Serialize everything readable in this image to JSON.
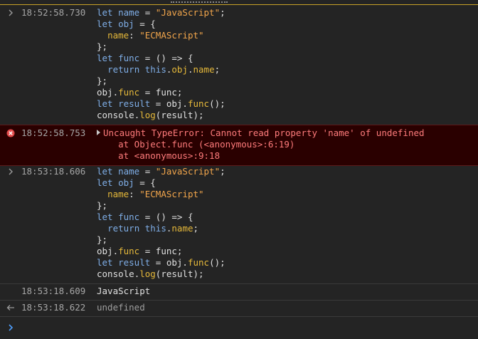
{
  "console": {
    "entries": [
      {
        "type": "input",
        "icon": "chevron-right-icon",
        "timestamp": "18:52:58.730",
        "lines": [
          [
            {
              "t": "let",
              "c": "kw"
            },
            {
              "t": " "
            },
            {
              "t": "name",
              "c": "kw"
            },
            {
              "t": " = "
            },
            {
              "t": "\"JavaScript\"",
              "c": "str"
            },
            {
              "t": ";"
            }
          ],
          [
            {
              "t": "let",
              "c": "kw"
            },
            {
              "t": " "
            },
            {
              "t": "obj",
              "c": "kw"
            },
            {
              "t": " = {"
            }
          ],
          [
            {
              "t": "  "
            },
            {
              "t": "name",
              "c": "prop"
            },
            {
              "t": ": "
            },
            {
              "t": "\"ECMAScript\"",
              "c": "str"
            }
          ],
          [
            {
              "t": "};"
            }
          ],
          [
            {
              "t": "let",
              "c": "kw"
            },
            {
              "t": " "
            },
            {
              "t": "func",
              "c": "kw"
            },
            {
              "t": " = () => {"
            }
          ],
          [
            {
              "t": "  "
            },
            {
              "t": "return",
              "c": "kw"
            },
            {
              "t": " "
            },
            {
              "t": "this",
              "c": "this"
            },
            {
              "t": "."
            },
            {
              "t": "obj",
              "c": "prop"
            },
            {
              "t": "."
            },
            {
              "t": "name",
              "c": "prop"
            },
            {
              "t": ";"
            }
          ],
          [
            {
              "t": "};"
            }
          ],
          [
            {
              "t": "obj"
            },
            {
              "t": "."
            },
            {
              "t": "func",
              "c": "prop"
            },
            {
              "t": " = func;"
            }
          ],
          [
            {
              "t": "let",
              "c": "kw"
            },
            {
              "t": " "
            },
            {
              "t": "result",
              "c": "kw"
            },
            {
              "t": " = obj."
            },
            {
              "t": "func",
              "c": "prop"
            },
            {
              "t": "();"
            }
          ],
          [
            {
              "t": "console"
            },
            {
              "t": "."
            },
            {
              "t": "log",
              "c": "prop"
            },
            {
              "t": "(result);"
            }
          ]
        ]
      },
      {
        "type": "error",
        "icon": "error-circle-icon",
        "timestamp": "18:52:58.753",
        "lines": [
          [
            {
              "t": "Uncaught TypeError: Cannot read property 'name' of undefined",
              "c": "err-text"
            }
          ],
          [
            {
              "t": "    at Object.func (<anonymous>:6:19)",
              "c": "err-text"
            }
          ],
          [
            {
              "t": "    at <anonymous>:9:18",
              "c": "err-text"
            }
          ]
        ]
      },
      {
        "type": "input",
        "icon": "chevron-right-icon",
        "timestamp": "18:53:18.606",
        "lines": [
          [
            {
              "t": "let",
              "c": "kw"
            },
            {
              "t": " "
            },
            {
              "t": "name",
              "c": "kw"
            },
            {
              "t": " = "
            },
            {
              "t": "\"JavaScript\"",
              "c": "str"
            },
            {
              "t": ";"
            }
          ],
          [
            {
              "t": "let",
              "c": "kw"
            },
            {
              "t": " "
            },
            {
              "t": "obj",
              "c": "kw"
            },
            {
              "t": " = {"
            }
          ],
          [
            {
              "t": "  "
            },
            {
              "t": "name",
              "c": "prop"
            },
            {
              "t": ": "
            },
            {
              "t": "\"ECMAScript\"",
              "c": "str"
            }
          ],
          [
            {
              "t": "};"
            }
          ],
          [
            {
              "t": "let",
              "c": "kw"
            },
            {
              "t": " "
            },
            {
              "t": "func",
              "c": "kw"
            },
            {
              "t": " = () => {"
            }
          ],
          [
            {
              "t": "  "
            },
            {
              "t": "return",
              "c": "kw"
            },
            {
              "t": " "
            },
            {
              "t": "this",
              "c": "this"
            },
            {
              "t": "."
            },
            {
              "t": "name",
              "c": "prop"
            },
            {
              "t": ";"
            }
          ],
          [
            {
              "t": "};"
            }
          ],
          [
            {
              "t": "obj"
            },
            {
              "t": "."
            },
            {
              "t": "func",
              "c": "prop"
            },
            {
              "t": " = func;"
            }
          ],
          [
            {
              "t": "let",
              "c": "kw"
            },
            {
              "t": " "
            },
            {
              "t": "result",
              "c": "kw"
            },
            {
              "t": " = obj."
            },
            {
              "t": "func",
              "c": "prop"
            },
            {
              "t": "();"
            }
          ],
          [
            {
              "t": "console"
            },
            {
              "t": "."
            },
            {
              "t": "log",
              "c": "prop"
            },
            {
              "t": "(result);"
            }
          ]
        ]
      },
      {
        "type": "log",
        "icon": "",
        "timestamp": "18:53:18.609",
        "lines": [
          [
            {
              "t": "JavaScript",
              "c": "plain"
            }
          ]
        ]
      },
      {
        "type": "result",
        "icon": "return-arrow-icon",
        "timestamp": "18:53:18.622",
        "lines": [
          [
            {
              "t": "undefined",
              "c": "muted"
            }
          ]
        ]
      }
    ],
    "prompt": {
      "icon": "chevron-right-icon",
      "value": ""
    }
  },
  "colors": {
    "background": "#242424",
    "error_background": "#2a0000",
    "error_text": "#ff7b7b",
    "keyword": "#7faee7",
    "string": "#f1a54b",
    "property": "#e6b93a",
    "prompt_accent": "#4e9dfb"
  }
}
